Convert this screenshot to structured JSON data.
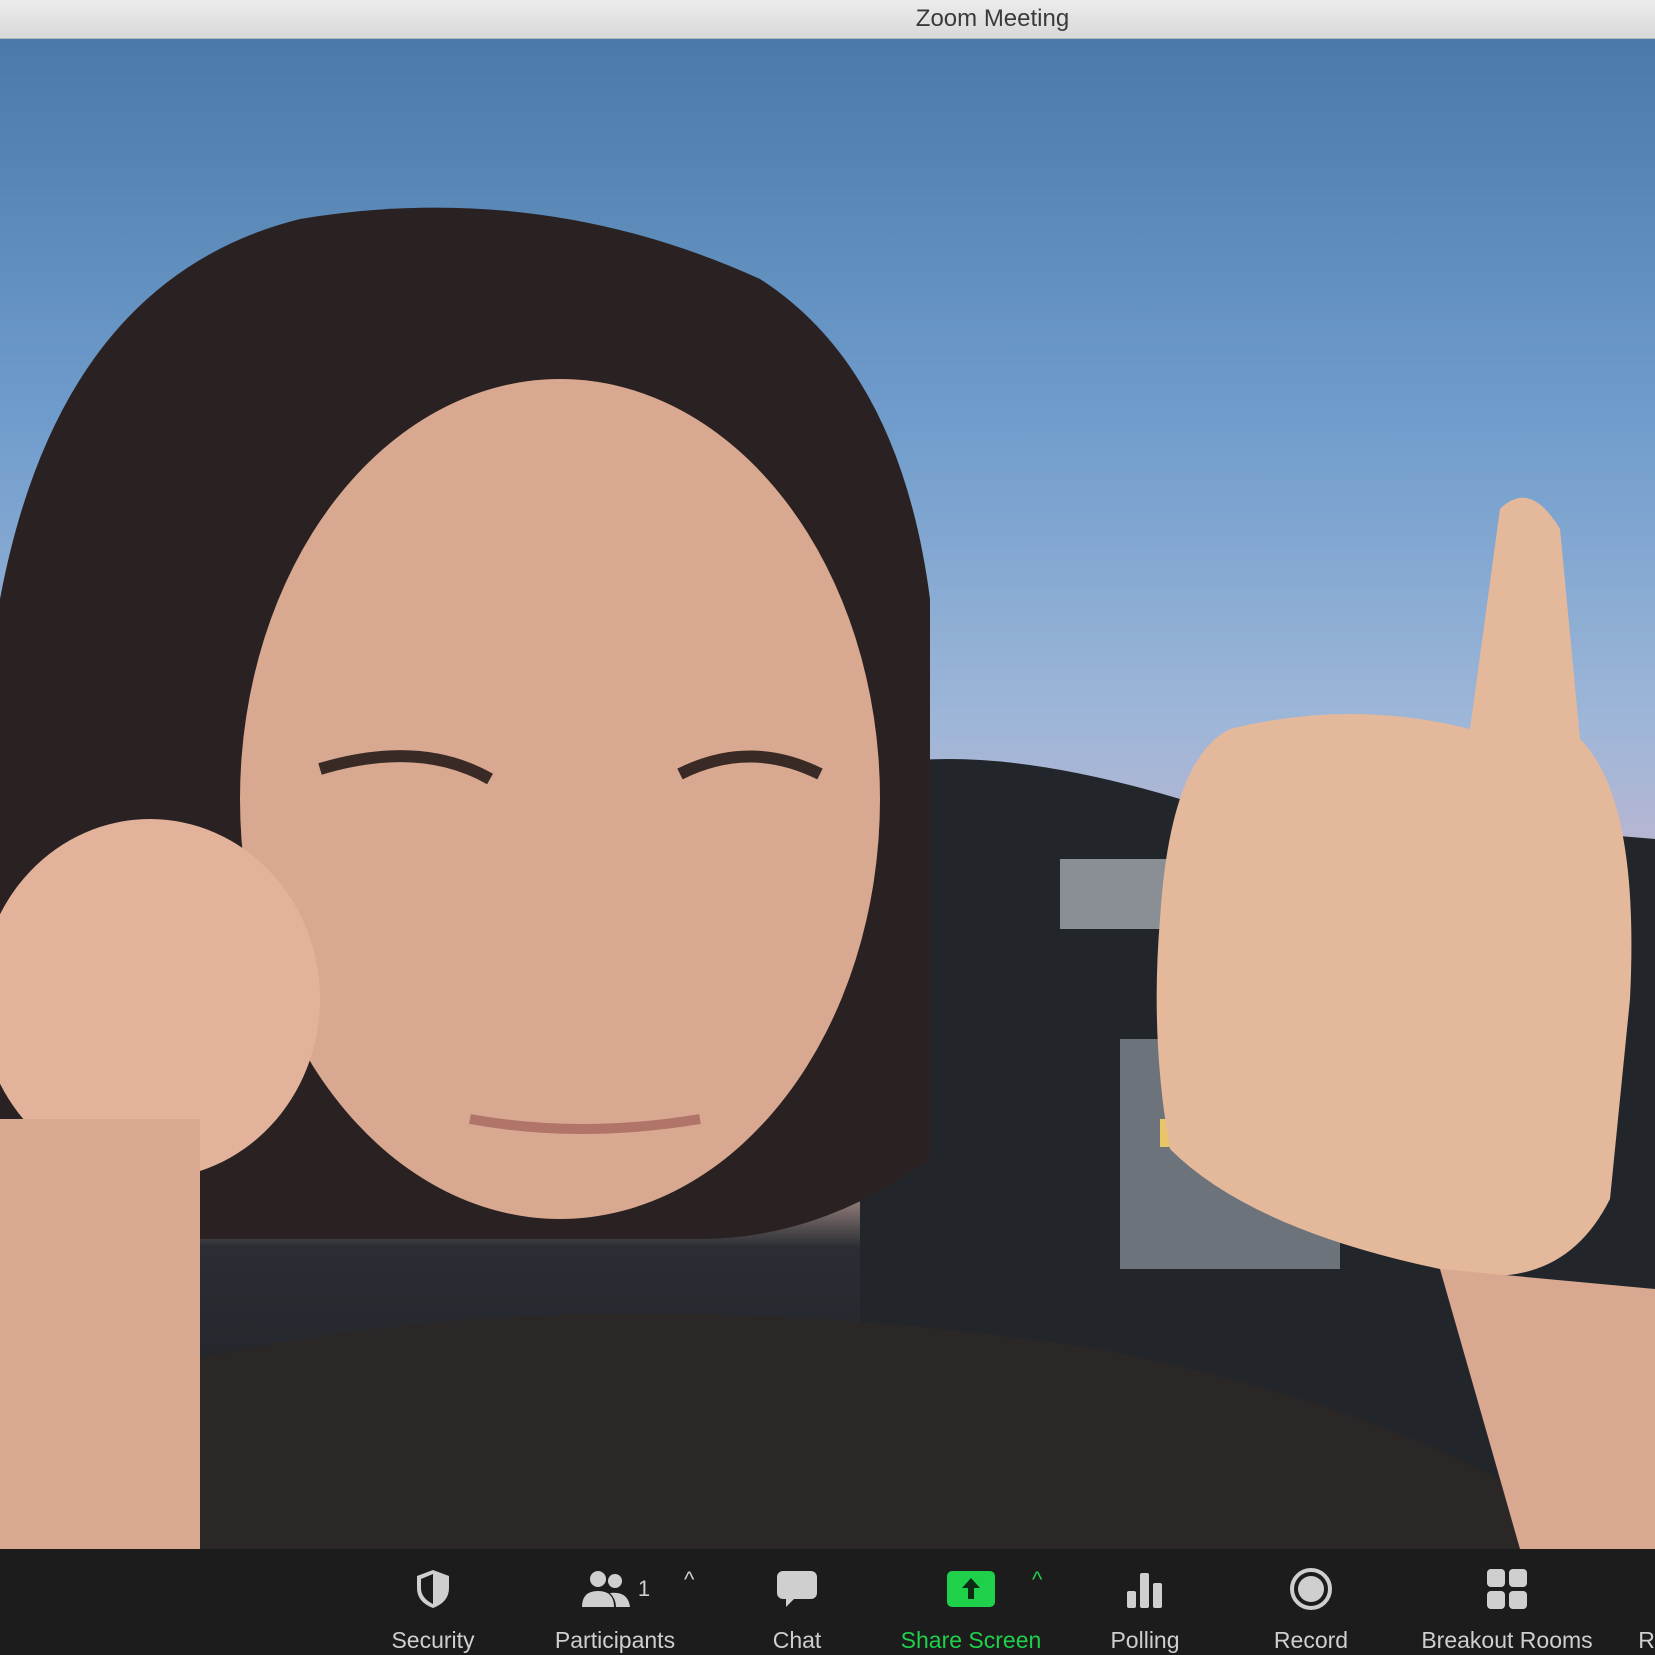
{
  "window": {
    "title": "Zoom Meeting"
  },
  "toolbar": {
    "items": [
      {
        "label": "Security",
        "icon": "shield-icon"
      },
      {
        "label": "Participants",
        "icon": "participants-icon",
        "count": "1"
      },
      {
        "label": "Chat",
        "icon": "chat-bubble-icon"
      },
      {
        "label": "Share Screen",
        "icon": "share-screen-icon"
      },
      {
        "label": "Polling",
        "icon": "bar-chart-icon"
      },
      {
        "label": "Record",
        "icon": "record-icon"
      },
      {
        "label": "Breakout Rooms",
        "icon": "grid-icon"
      },
      {
        "label": "R",
        "icon": ""
      }
    ]
  },
  "colors": {
    "share_green": "#1fd14a",
    "toolbar_bg": "#1c1c1c",
    "titlebar_bg": "#e3e3e3"
  }
}
